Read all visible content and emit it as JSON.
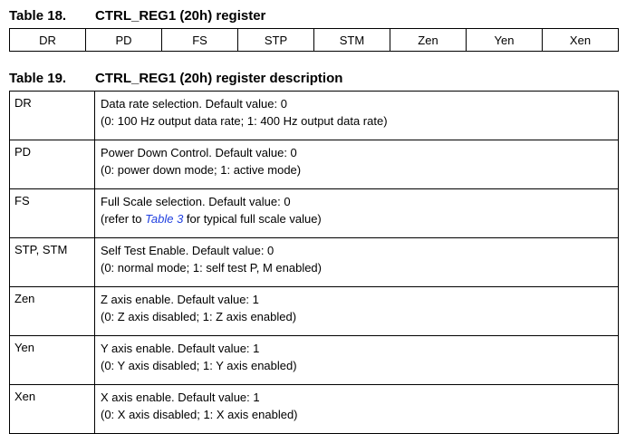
{
  "table18": {
    "number": "Table 18.",
    "title": "CTRL_REG1 (20h) register",
    "bits": [
      "DR",
      "PD",
      "FS",
      "STP",
      "STM",
      "Zen",
      "Yen",
      "Xen"
    ]
  },
  "table19": {
    "number": "Table 19.",
    "title": "CTRL_REG1 (20h) register description",
    "rows": [
      {
        "name": "DR",
        "line1": "Data rate selection. Default value: 0",
        "line2": "(0: 100 Hz output data rate; 1: 400 Hz output data rate)"
      },
      {
        "name": "PD",
        "line1": "Power Down Control. Default value: 0",
        "line2": "(0: power down mode; 1: active mode)"
      },
      {
        "name": "FS",
        "line1": "Full Scale selection. Default value: 0",
        "line2_pre": "(refer to ",
        "line2_link": "Table 3",
        "line2_post": " for typical full scale value)"
      },
      {
        "name": "STP, STM",
        "line1": "Self Test Enable. Default value: 0",
        "line2": "(0: normal mode; 1: self test P, M enabled)"
      },
      {
        "name": "Zen",
        "line1": "Z axis enable. Default value: 1",
        "line2": "(0: Z axis disabled; 1: Z axis enabled)"
      },
      {
        "name": "Yen",
        "line1": "Y axis enable. Default value: 1",
        "line2": "(0: Y axis disabled; 1: Y axis enabled)"
      },
      {
        "name": "Xen",
        "line1": "X axis enable. Default value: 1",
        "line2": "(0: X axis disabled; 1: X axis enabled)"
      }
    ]
  },
  "colors": {
    "link": "#1f3fe0"
  }
}
